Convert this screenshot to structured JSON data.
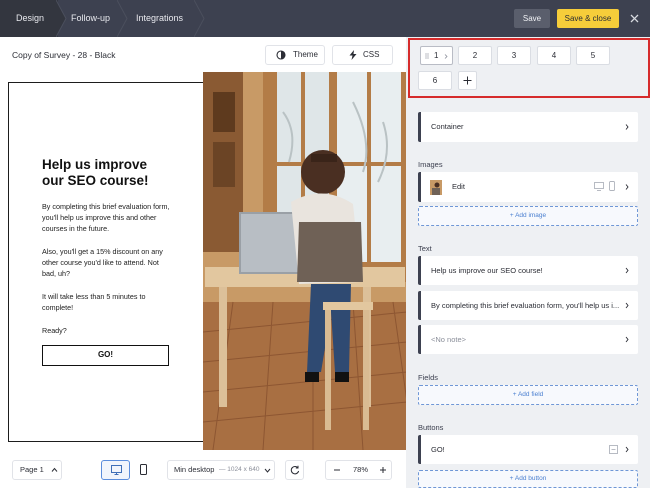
{
  "topbar": {
    "tabs": [
      "Design",
      "Follow-up",
      "Integrations"
    ],
    "save_label": "Save",
    "save_close_label": "Save & close"
  },
  "canvas": {
    "survey_title": "Copy of Survey - 28 - Black",
    "theme_label": "Theme",
    "css_label": "CSS"
  },
  "preview": {
    "heading": "Help us improve our SEO course!",
    "para1": "By completing this brief evaluation form, you'll help us improve this and other courses in the future.",
    "para2": "Also, you'll get a 15% discount on any other course you'd like to attend. Not bad, uh?",
    "para3": "It will take less than 5 minutes to complete!",
    "para4": "Ready?",
    "button": "GO!"
  },
  "bottom": {
    "page_select": "Page 1",
    "viewport_label": "Min desktop",
    "viewport_size": "— 1024 x 640",
    "zoom": "78%"
  },
  "panel": {
    "pages": [
      "1",
      "2",
      "3",
      "4",
      "5",
      "6"
    ],
    "container_label": "Container",
    "images_label": "Images",
    "image_edit": "Edit",
    "add_image": "+ Add image",
    "text_label": "Text",
    "text_items": [
      "Help us improve our SEO course!",
      "By completing this brief evaluation form, you'll help us i...",
      "<No note>"
    ],
    "fields_label": "Fields",
    "add_field": "+ Add field",
    "buttons_label": "Buttons",
    "button_item": "GO!",
    "add_button": "+ Add button"
  },
  "colors": {
    "topbar": "#3d4150",
    "accent": "#f6cd3a",
    "highlight": "#d62b2b",
    "link": "#4a7fd0"
  }
}
